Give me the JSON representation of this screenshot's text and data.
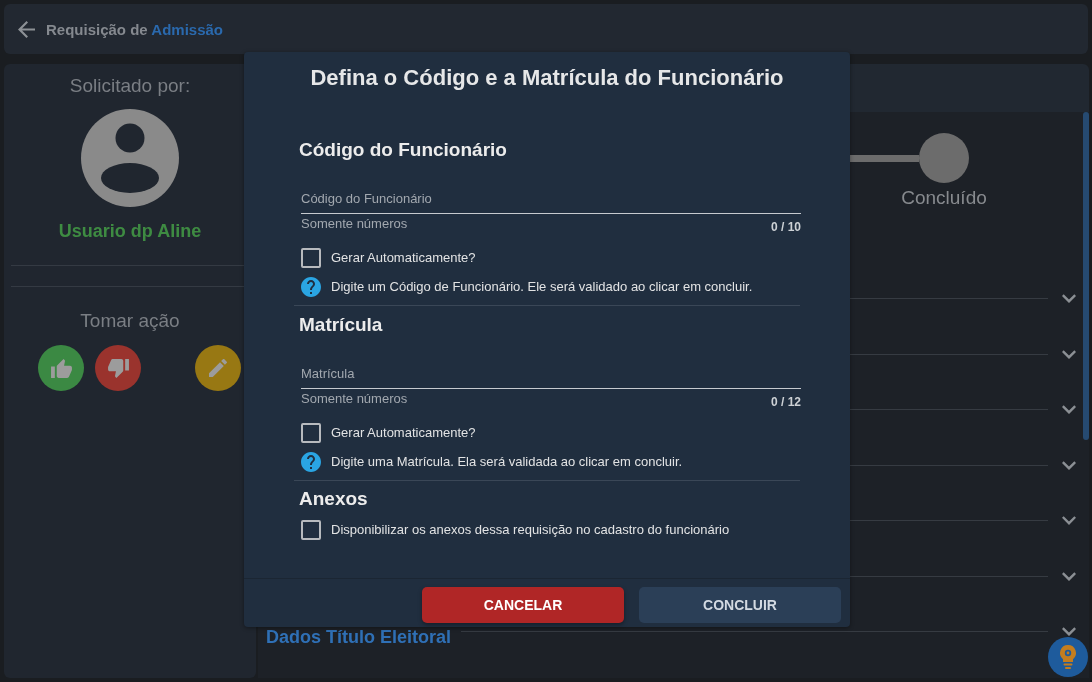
{
  "header": {
    "title": "Requisição de",
    "subject": "Admissão"
  },
  "requester": {
    "label": "Solicitado por:",
    "name": "Usuario dp Aline"
  },
  "actions": {
    "label": "Tomar ação",
    "buttons": [
      {
        "kind": "approve"
      },
      {
        "kind": "reject"
      },
      {
        "kind": "edit"
      }
    ]
  },
  "stepper": {
    "steps": [
      {
        "label": "Concluído"
      }
    ]
  },
  "accordion": [
    {
      "expanded": false
    },
    {
      "expanded": false
    },
    {
      "expanded": false
    },
    {
      "expanded": false
    },
    {
      "expanded": false
    },
    {
      "expanded": false
    },
    {
      "title": "Dados Título Eleitoral",
      "expanded": false
    }
  ],
  "dialog": {
    "title": "Defina o Código e a Matrícula do Funcionário",
    "sections": [
      {
        "kind": "field",
        "heading": "Código do Funcionário",
        "placeholder": "Código do Funcionário",
        "hint": "Somente números",
        "counter": "0 / 10",
        "checkbox": {
          "label": "Gerar Automaticamente?",
          "checked": false
        },
        "help": "Digite um Código de Funcionário. Ele será validado ao clicar em concluir."
      },
      {
        "kind": "field",
        "heading": "Matrícula",
        "placeholder": "Matrícula",
        "hint": "Somente números",
        "counter": "0 / 12",
        "checkbox": {
          "label": "Gerar Automaticamente?",
          "checked": false
        },
        "help": "Digite uma Matrícula. Ela será validada ao clicar em concluir."
      },
      {
        "kind": "option",
        "heading": "Anexos",
        "checkbox": {
          "label": "Disponibilizar os anexos dessa requisição no cadastro do funcionário",
          "checked": false
        }
      }
    ],
    "buttons": [
      {
        "label": "CANCELAR",
        "kind": "cancel",
        "disabled": false
      },
      {
        "label": "CONCLUIR",
        "kind": "confirm",
        "disabled": true
      }
    ]
  }
}
